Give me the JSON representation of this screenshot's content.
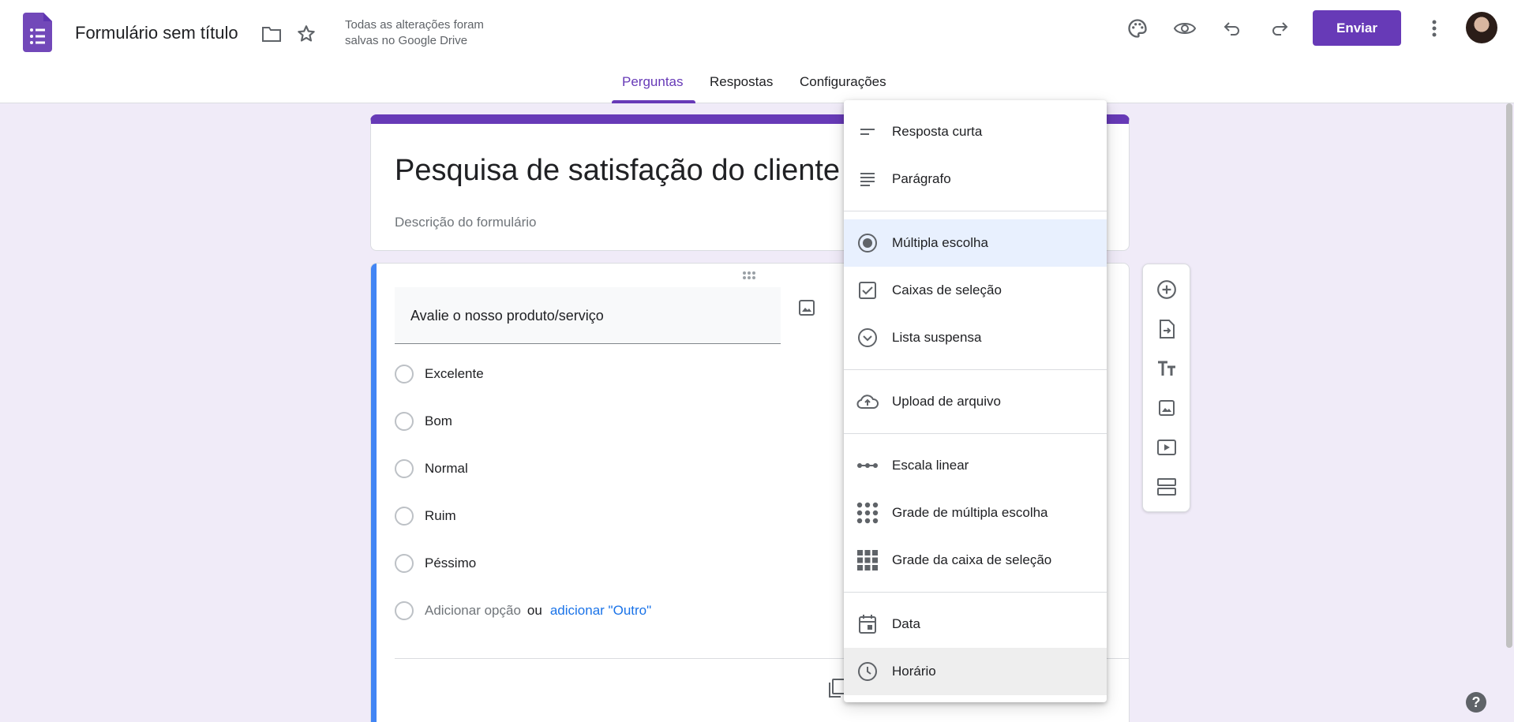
{
  "header": {
    "doc_title": "Formulário sem título",
    "save_status_line1": "Todas as alterações foram",
    "save_status_line2": "salvas no Google Drive",
    "send_label": "Enviar"
  },
  "tabs": [
    {
      "label": "Perguntas",
      "active": true
    },
    {
      "label": "Respostas",
      "active": false
    },
    {
      "label": "Configurações",
      "active": false
    }
  ],
  "form": {
    "title": "Pesquisa de satisfação do cliente",
    "description_placeholder": "Descrição do formulário"
  },
  "question": {
    "text": "Avalie o nosso produto/serviço",
    "options": [
      "Excelente",
      "Bom",
      "Normal",
      "Ruim",
      "Péssimo"
    ],
    "add_option": "Adicionar opção",
    "or": "ou",
    "add_other": "adicionar \"Outro\""
  },
  "menu": {
    "items": [
      {
        "label": "Resposta curta",
        "icon": "short-answer-icon"
      },
      {
        "label": "Parágrafo",
        "icon": "paragraph-icon"
      },
      {
        "label": "Múltipla escolha",
        "icon": "radio-icon",
        "selected": true
      },
      {
        "label": "Caixas de seleção",
        "icon": "checkbox-icon"
      },
      {
        "label": "Lista suspensa",
        "icon": "dropdown-icon"
      },
      {
        "label": "Upload de arquivo",
        "icon": "cloud-upload-icon"
      },
      {
        "label": "Escala linear",
        "icon": "linear-scale-icon"
      },
      {
        "label": "Grade de múltipla escolha",
        "icon": "grid-dots-icon"
      },
      {
        "label": "Grade da caixa de seleção",
        "icon": "grid-squares-icon"
      },
      {
        "label": "Data",
        "icon": "calendar-icon"
      },
      {
        "label": "Horário",
        "icon": "clock-icon",
        "hover": true
      }
    ]
  },
  "colors": {
    "accent": "#673ab7",
    "background": "#f0ebf8",
    "question_accent": "#4285f4",
    "link": "#1a73e8"
  }
}
